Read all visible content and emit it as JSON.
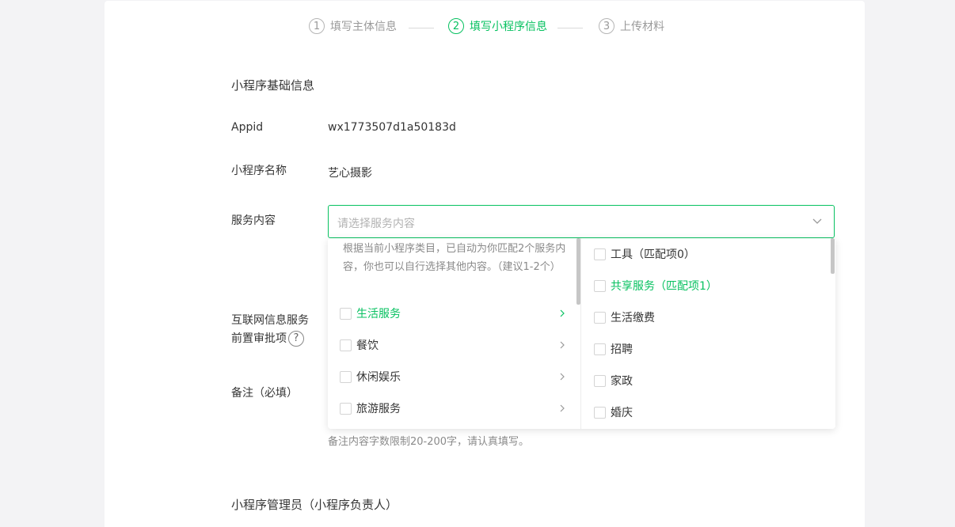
{
  "stepper": {
    "steps": [
      {
        "num": "1",
        "label": "填写主体信息"
      },
      {
        "num": "2",
        "label": "填写小程序信息"
      },
      {
        "num": "3",
        "label": "上传材料"
      }
    ]
  },
  "basic": {
    "title": "小程序基础信息",
    "appid_label": "Appid",
    "appid_value": "wx1773507d1a50183d",
    "name_label": "小程序名称",
    "name_value": "艺心摄影",
    "service_label": "服务内容",
    "service_placeholder": "请选择服务内容",
    "internet_label_line1": "互联网信息服务",
    "internet_label_line2": "前置审批项",
    "help_icon_glyph": "?",
    "remark_label": "备注（必填）",
    "remark_hint": "备注内容字数限制20-200字，请认真填写。"
  },
  "admin": {
    "title": "小程序管理员（小程序负责人）"
  },
  "dropdown": {
    "description": "根据当前小程序类目，已自动为你匹配2个服务内容，你也可以自行选择其他内容。（建议1-2个）",
    "categories": [
      {
        "label": "生活服务",
        "active": true
      },
      {
        "label": "餐饮",
        "active": false
      },
      {
        "label": "休闲娱乐",
        "active": false
      },
      {
        "label": "旅游服务",
        "active": false
      }
    ],
    "subitems": [
      {
        "label": "工具（匹配项0）",
        "active": false
      },
      {
        "label": "共享服务（匹配项1）",
        "active": true
      },
      {
        "label": "生活缴费",
        "active": false
      },
      {
        "label": "招聘",
        "active": false
      },
      {
        "label": "家政",
        "active": false
      },
      {
        "label": "婚庆",
        "active": false
      }
    ]
  },
  "colors": {
    "accent": "#07c160",
    "background": "#f3f3f5"
  }
}
